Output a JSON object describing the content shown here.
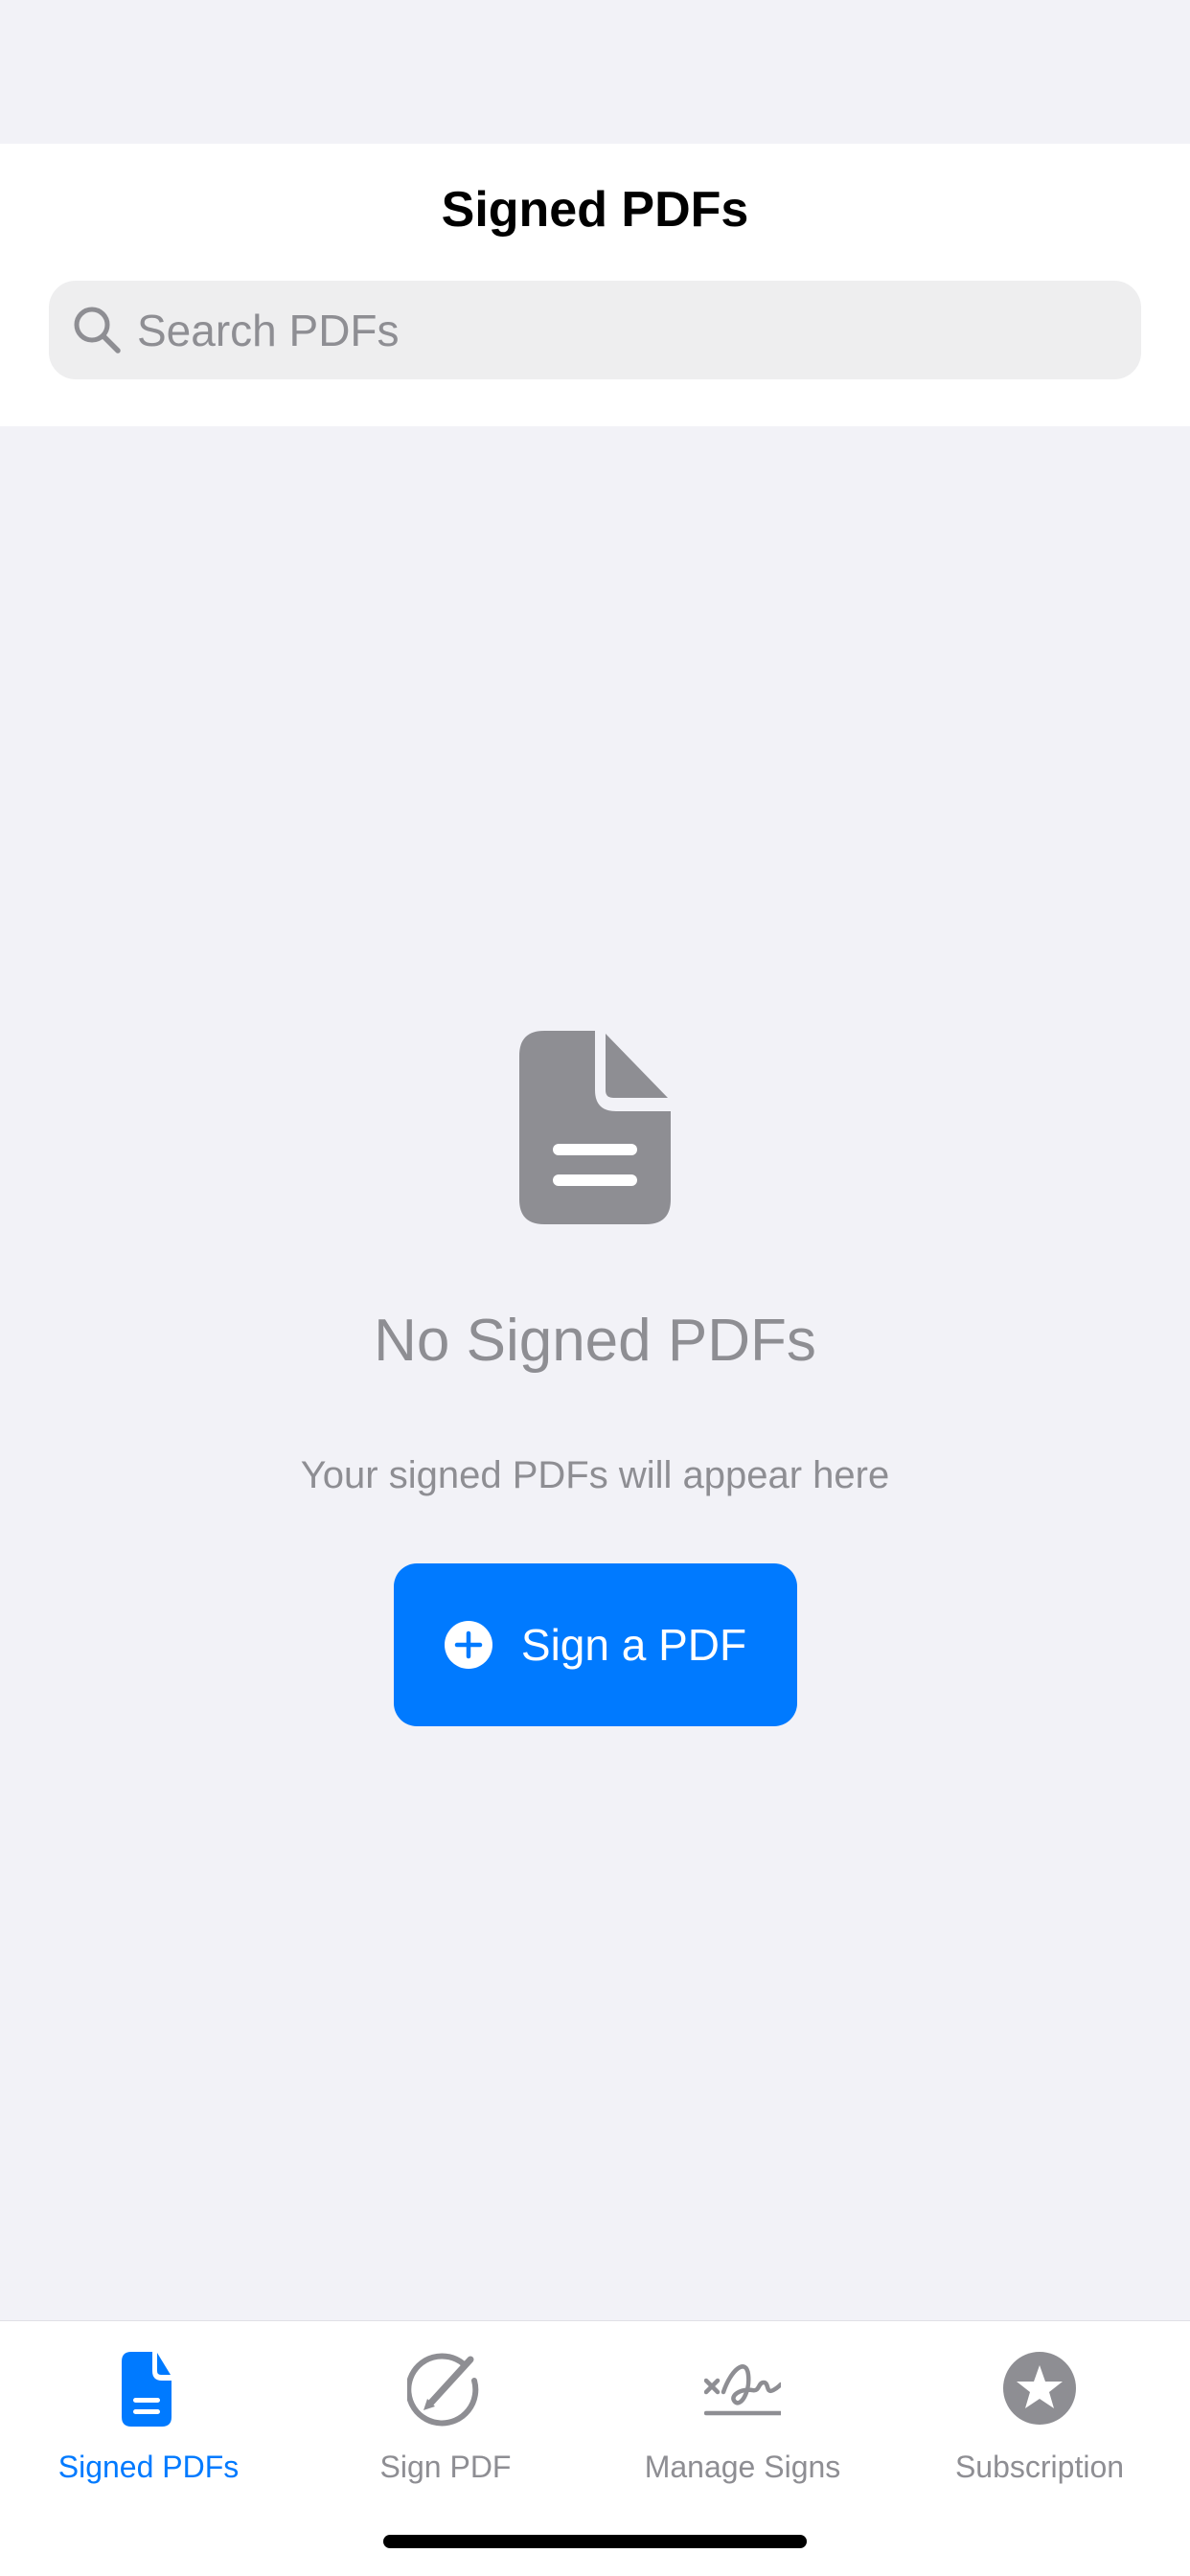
{
  "header": {
    "title": "Signed PDFs"
  },
  "search": {
    "placeholder": "Search PDFs",
    "value": "",
    "icon": "search-icon"
  },
  "empty_state": {
    "icon": "document-icon",
    "title": "No Signed PDFs",
    "subtitle": "Your signed PDFs will appear here",
    "button_label": "Sign a PDF",
    "button_icon": "plus-circle-icon"
  },
  "tabs": [
    {
      "label": "Signed PDFs",
      "icon": "document-icon",
      "active": true
    },
    {
      "label": "Sign PDF",
      "icon": "pencil-circle-icon",
      "active": false
    },
    {
      "label": "Manage Signs",
      "icon": "signature-icon",
      "active": false
    },
    {
      "label": "Subscription",
      "icon": "star-circle-icon",
      "active": false
    }
  ],
  "colors": {
    "accent": "#007AFF",
    "background": "#F2F2F7",
    "secondary_text": "#8E8E93",
    "inactive_icon": "#8E8E93",
    "search_field": "#EEEEEF"
  }
}
